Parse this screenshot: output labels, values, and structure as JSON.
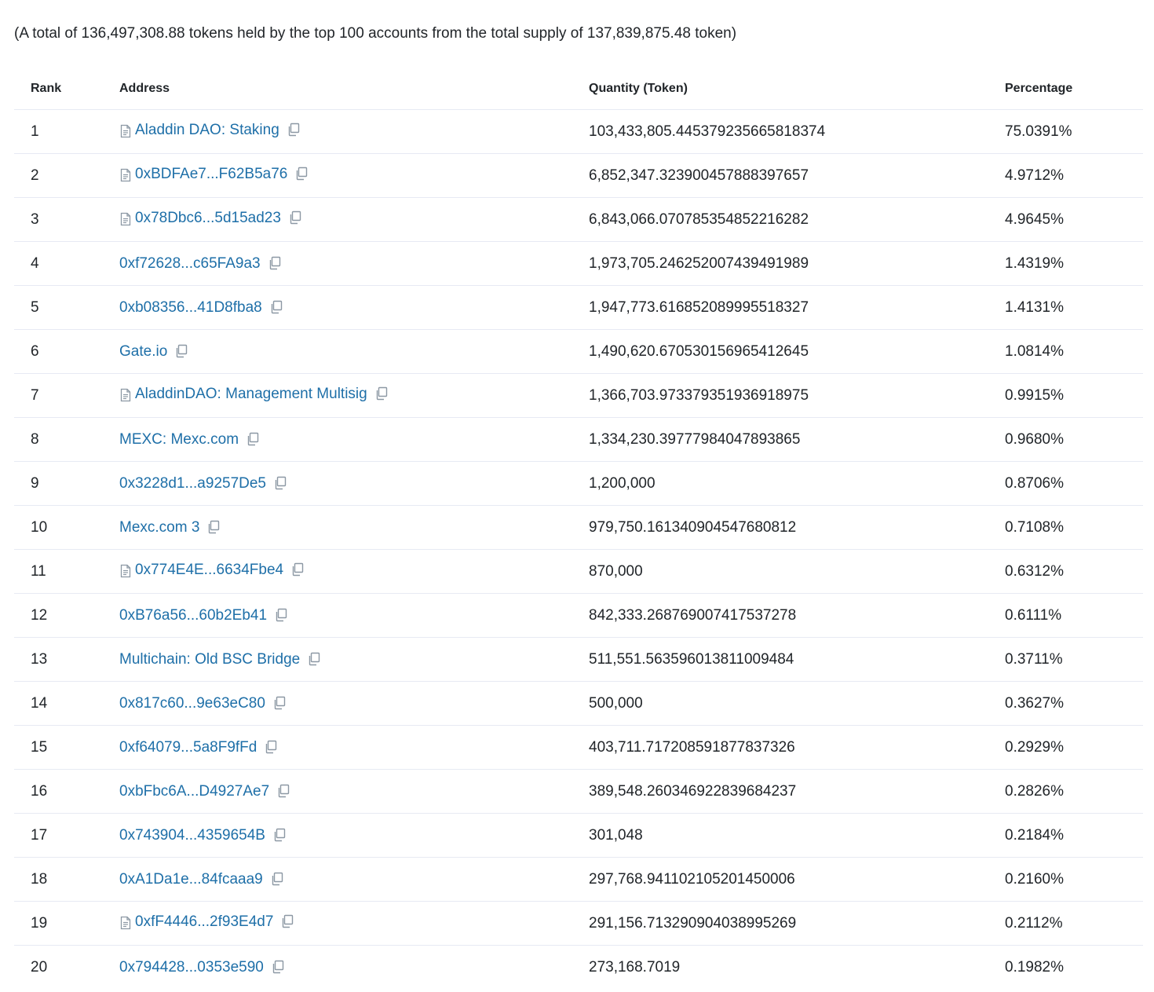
{
  "summary": "(A total of 136,497,308.88 tokens held by the top 100 accounts from the total supply of 137,839,875.48 token)",
  "columns": {
    "rank": "Rank",
    "address": "Address",
    "quantity": "Quantity (Token)",
    "percentage": "Percentage"
  },
  "colors": {
    "link": "#1e6fa8",
    "icon": "#8c98a4",
    "divider": "#e7eaf3"
  },
  "rows": [
    {
      "rank": "1",
      "address": "Aladdin DAO: Staking",
      "contract": true,
      "quantity": "103,433,805.445379235665818374",
      "percentage": "75.0391%"
    },
    {
      "rank": "2",
      "address": "0xBDFAe7...F62B5a76",
      "contract": true,
      "quantity": "6,852,347.323900457888397657",
      "percentage": "4.9712%"
    },
    {
      "rank": "3",
      "address": "0x78Dbc6...5d15ad23",
      "contract": true,
      "quantity": "6,843,066.070785354852216282",
      "percentage": "4.9645%"
    },
    {
      "rank": "4",
      "address": "0xf72628...c65FA9a3",
      "contract": false,
      "quantity": "1,973,705.246252007439491989",
      "percentage": "1.4319%"
    },
    {
      "rank": "5",
      "address": "0xb08356...41D8fba8",
      "contract": false,
      "quantity": "1,947,773.616852089995518327",
      "percentage": "1.4131%"
    },
    {
      "rank": "6",
      "address": "Gate.io",
      "contract": false,
      "quantity": "1,490,620.670530156965412645",
      "percentage": "1.0814%"
    },
    {
      "rank": "7",
      "address": "AladdinDAO: Management Multisig",
      "contract": true,
      "quantity": "1,366,703.973379351936918975",
      "percentage": "0.9915%"
    },
    {
      "rank": "8",
      "address": "MEXC: Mexc.com",
      "contract": false,
      "quantity": "1,334,230.39777984047893865",
      "percentage": "0.9680%"
    },
    {
      "rank": "9",
      "address": "0x3228d1...a9257De5",
      "contract": false,
      "quantity": "1,200,000",
      "percentage": "0.8706%"
    },
    {
      "rank": "10",
      "address": "Mexc.com 3",
      "contract": false,
      "quantity": "979,750.161340904547680812",
      "percentage": "0.7108%"
    },
    {
      "rank": "11",
      "address": "0x774E4E...6634Fbe4",
      "contract": true,
      "quantity": "870,000",
      "percentage": "0.6312%"
    },
    {
      "rank": "12",
      "address": "0xB76a56...60b2Eb41",
      "contract": false,
      "quantity": "842,333.268769007417537278",
      "percentage": "0.6111%"
    },
    {
      "rank": "13",
      "address": "Multichain: Old BSC Bridge",
      "contract": false,
      "quantity": "511,551.563596013811009484",
      "percentage": "0.3711%"
    },
    {
      "rank": "14",
      "address": "0x817c60...9e63eC80",
      "contract": false,
      "quantity": "500,000",
      "percentage": "0.3627%"
    },
    {
      "rank": "15",
      "address": "0xf64079...5a8F9fFd",
      "contract": false,
      "quantity": "403,711.717208591877837326",
      "percentage": "0.2929%"
    },
    {
      "rank": "16",
      "address": "0xbFbc6A...D4927Ae7",
      "contract": false,
      "quantity": "389,548.260346922839684237",
      "percentage": "0.2826%"
    },
    {
      "rank": "17",
      "address": "0x743904...4359654B",
      "contract": false,
      "quantity": "301,048",
      "percentage": "0.2184%"
    },
    {
      "rank": "18",
      "address": "0xA1Da1e...84fcaaa9",
      "contract": false,
      "quantity": "297,768.941102105201450006",
      "percentage": "0.2160%"
    },
    {
      "rank": "19",
      "address": "0xfF4446...2f93E4d7",
      "contract": true,
      "quantity": "291,156.713290904038995269",
      "percentage": "0.2112%"
    },
    {
      "rank": "20",
      "address": "0x794428...0353e590",
      "contract": false,
      "quantity": "273,168.7019",
      "percentage": "0.1982%"
    }
  ]
}
